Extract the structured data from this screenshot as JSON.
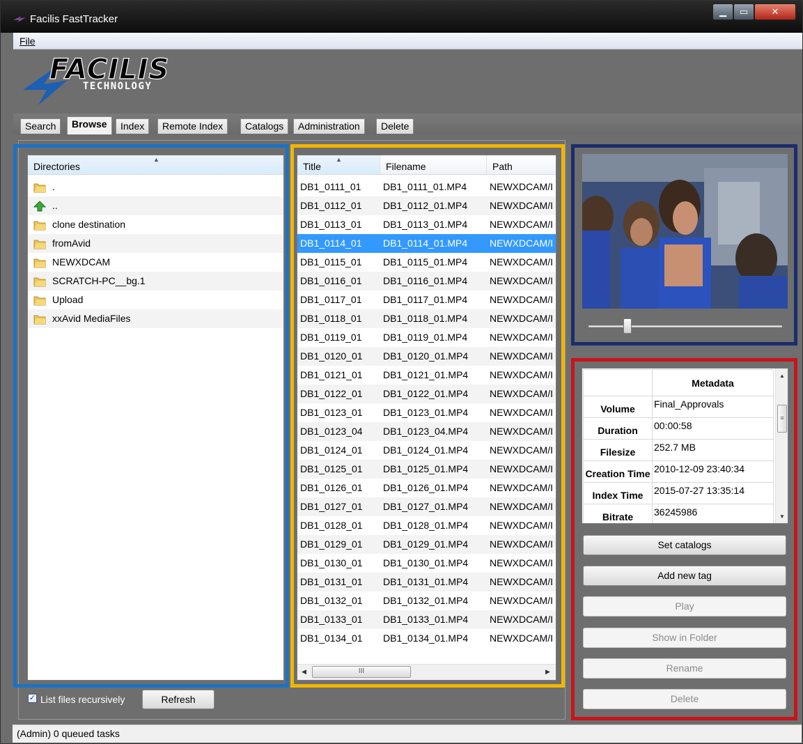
{
  "window": {
    "title": "Facilis FastTracker",
    "controls": [
      "minimize",
      "maximize",
      "close"
    ]
  },
  "menu": {
    "file_label": "File"
  },
  "logo": {
    "name": "FACILIS",
    "tagline": "TECHNOLOGY",
    "brand_color": "#1c5fb3"
  },
  "tabs": [
    {
      "label": "Search",
      "active": false
    },
    {
      "label": "Browse",
      "active": true
    },
    {
      "label": "Index",
      "active": false
    },
    {
      "label": "Remote Index",
      "active": false
    },
    {
      "label": "Catalogs",
      "active": false
    },
    {
      "label": "Administration",
      "active": false
    },
    {
      "label": "Delete",
      "active": false
    }
  ],
  "directories": {
    "header": "Directories",
    "items": [
      {
        "label": ".",
        "icon": "folder-icon"
      },
      {
        "label": "..",
        "icon": "up-arrow-icon"
      },
      {
        "label": "clone destination",
        "icon": "folder-icon"
      },
      {
        "label": "fromAvid",
        "icon": "folder-icon"
      },
      {
        "label": "NEWXDCAM",
        "icon": "folder-icon"
      },
      {
        "label": "SCRATCH-PC__bg.1",
        "icon": "folder-icon"
      },
      {
        "label": "Upload",
        "icon": "folder-icon"
      },
      {
        "label": "xxAvid MediaFiles",
        "icon": "folder-icon"
      }
    ],
    "recursive_label": "List files recursively",
    "recursive_checked": true,
    "refresh_label": "Refresh"
  },
  "files": {
    "columns": [
      "Title",
      "Filename",
      "Path"
    ],
    "selected_index": 3,
    "rows": [
      [
        "DB1_0111_01",
        "DB1_0111_01.MP4",
        "NEWXDCAM/I"
      ],
      [
        "DB1_0112_01",
        "DB1_0112_01.MP4",
        "NEWXDCAM/I"
      ],
      [
        "DB1_0113_01",
        "DB1_0113_01.MP4",
        "NEWXDCAM/I"
      ],
      [
        "DB1_0114_01",
        "DB1_0114_01.MP4",
        "NEWXDCAM/I"
      ],
      [
        "DB1_0115_01",
        "DB1_0115_01.MP4",
        "NEWXDCAM/I"
      ],
      [
        "DB1_0116_01",
        "DB1_0116_01.MP4",
        "NEWXDCAM/I"
      ],
      [
        "DB1_0117_01",
        "DB1_0117_01.MP4",
        "NEWXDCAM/I"
      ],
      [
        "DB1_0118_01",
        "DB1_0118_01.MP4",
        "NEWXDCAM/I"
      ],
      [
        "DB1_0119_01",
        "DB1_0119_01.MP4",
        "NEWXDCAM/I"
      ],
      [
        "DB1_0120_01",
        "DB1_0120_01.MP4",
        "NEWXDCAM/I"
      ],
      [
        "DB1_0121_01",
        "DB1_0121_01.MP4",
        "NEWXDCAM/I"
      ],
      [
        "DB1_0122_01",
        "DB1_0122_01.MP4",
        "NEWXDCAM/I"
      ],
      [
        "DB1_0123_01",
        "DB1_0123_01.MP4",
        "NEWXDCAM/I"
      ],
      [
        "DB1_0123_04",
        "DB1_0123_04.MP4",
        "NEWXDCAM/I"
      ],
      [
        "DB1_0124_01",
        "DB1_0124_01.MP4",
        "NEWXDCAM/I"
      ],
      [
        "DB1_0125_01",
        "DB1_0125_01.MP4",
        "NEWXDCAM/I"
      ],
      [
        "DB1_0126_01",
        "DB1_0126_01.MP4",
        "NEWXDCAM/I"
      ],
      [
        "DB1_0127_01",
        "DB1_0127_01.MP4",
        "NEWXDCAM/I"
      ],
      [
        "DB1_0128_01",
        "DB1_0128_01.MP4",
        "NEWXDCAM/I"
      ],
      [
        "DB1_0129_01",
        "DB1_0129_01.MP4",
        "NEWXDCAM/I"
      ],
      [
        "DB1_0130_01",
        "DB1_0130_01.MP4",
        "NEWXDCAM/I"
      ],
      [
        "DB1_0131_01",
        "DB1_0131_01.MP4",
        "NEWXDCAM/I"
      ],
      [
        "DB1_0132_01",
        "DB1_0132_01.MP4",
        "NEWXDCAM/I"
      ],
      [
        "DB1_0133_01",
        "DB1_0133_01.MP4",
        "NEWXDCAM/I"
      ],
      [
        "DB1_0134_01",
        "DB1_0134_01.MP4",
        "NEWXDCAM/I"
      ]
    ],
    "hscroll_thumb": "III"
  },
  "preview": {
    "slider_position": 0.2
  },
  "metadata": {
    "header": "Metadata",
    "rows": [
      {
        "key": "Volume",
        "value": "Final_Approvals"
      },
      {
        "key": "Duration",
        "value": "00:00:58"
      },
      {
        "key": "Filesize",
        "value": "252.7 MB"
      },
      {
        "key": "Creation Time",
        "value": "2010-12-09 23:40:34"
      },
      {
        "key": "Index Time",
        "value": "2015-07-27 13:35:14"
      },
      {
        "key": "Bitrate",
        "value": "36245986"
      }
    ]
  },
  "actions": [
    {
      "label": "Set catalogs",
      "enabled": true
    },
    {
      "label": "Add new tag",
      "enabled": true
    },
    {
      "label": "Play",
      "enabled": false
    },
    {
      "label": "Show in Folder",
      "enabled": false
    },
    {
      "label": "Rename",
      "enabled": false
    },
    {
      "label": "Delete",
      "enabled": false
    }
  ],
  "status": {
    "text": "(Admin) 0 queued tasks"
  },
  "colors": {
    "selection": "#3399ff",
    "highlight_blue": "#1c72c4",
    "highlight_yellow": "#f2b600",
    "highlight_navy": "#1b2d6b",
    "highlight_red": "#c8141c"
  }
}
